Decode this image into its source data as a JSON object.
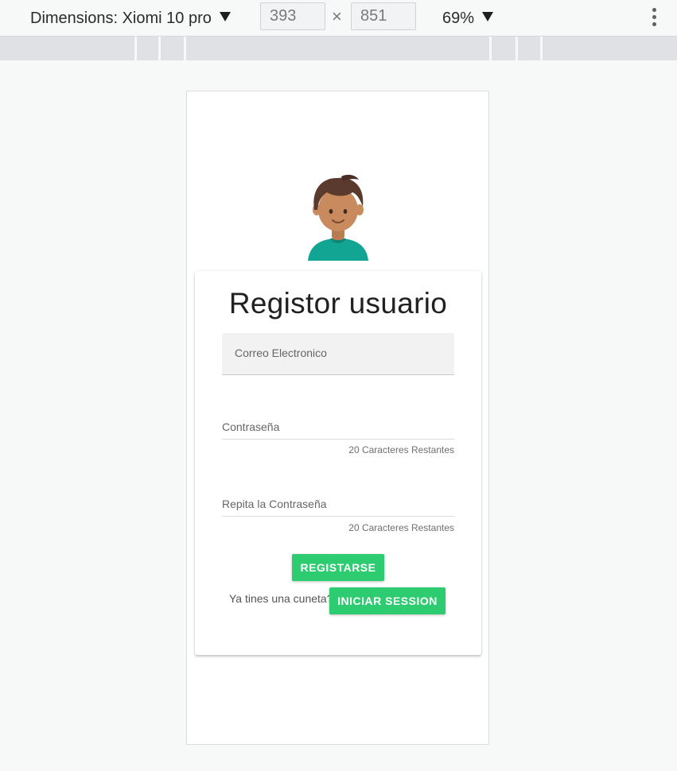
{
  "devtools": {
    "dimensions_label": "Dimensions: Xiomi 10 pro",
    "width": "393",
    "height": "851",
    "times": "×",
    "zoom": "69%"
  },
  "form": {
    "title": "Registor usuario",
    "email_label": "Correo Electronico",
    "password_label": "Contraseña",
    "password_counter": "20 Caracteres Restantes",
    "repeat_label": "Repita la Contraseña",
    "repeat_counter": "20 Caracteres Restantes",
    "register_button": "REGISTARSE",
    "account_prompt": "Ya tines una cuneta?",
    "login_button": "INICIAR SESSION"
  },
  "colors": {
    "accent": "#2ecc71",
    "avatar_shirt": "#12a594",
    "avatar_hair": "#5b3a2e",
    "avatar_skin": "#c98b5e"
  },
  "icons": [
    "caret-down-icon",
    "more-vert-icon",
    "user-avatar-icon"
  ]
}
